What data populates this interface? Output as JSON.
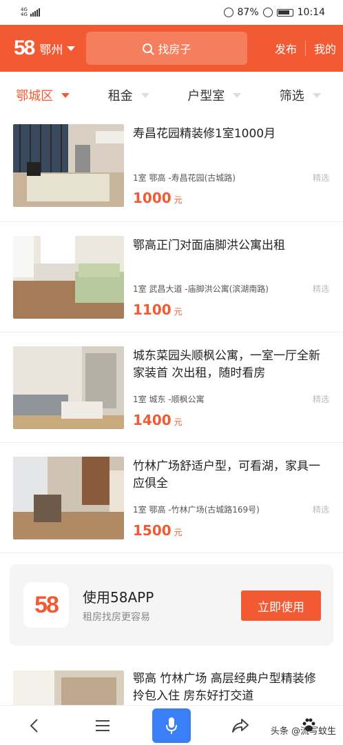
{
  "status_bar": {
    "network": "4G",
    "network_sub": "4G",
    "battery": "87%",
    "time": "10:14"
  },
  "header": {
    "logo": "58",
    "city": "鄂州",
    "search_placeholder": "找房子",
    "publish": "发布",
    "mine": "我的"
  },
  "filters": [
    {
      "label": "鄂城区",
      "active": true
    },
    {
      "label": "租金",
      "active": false
    },
    {
      "label": "户型室",
      "active": false
    },
    {
      "label": "筛选",
      "active": false
    }
  ],
  "listings": [
    {
      "title": "寿昌花园精装修1室1000月",
      "meta": "1室 鄂高 -寿昌花园(古城路)",
      "tag": "精选",
      "price": "1000",
      "unit": "元"
    },
    {
      "title": "鄂高正门对面庙脚洪公寓出租",
      "meta": "1室 武昌大道 -庙脚洪公寓(滨湖南路)",
      "tag": "精选",
      "price": "1100",
      "unit": "元"
    },
    {
      "title": "城东菜园头顺枫公寓，一室一厅全新家装首 次出租，随时看房",
      "meta": "1室 城东 -顺枫公寓",
      "tag": "精选",
      "price": "1400",
      "unit": "元"
    },
    {
      "title": "竹林广场舒适户型，可看湖，家具一应俱全",
      "meta": "1室 鄂高 -竹林广场(古城路169号)",
      "tag": "精选",
      "price": "1500",
      "unit": "元"
    }
  ],
  "promo": {
    "logo": "58",
    "title": "使用58APP",
    "subtitle": "租房找房更容易",
    "button": "立即使用"
  },
  "partial_listing": {
    "title": "鄂高 竹林广场 高层经典户型精装修 拎包入住 房东好打交道"
  },
  "watermark": "头条 @流写蚊生",
  "colors": {
    "accent": "#f25a33",
    "mic": "#3b7ff6"
  },
  "icons": {
    "back": "back-icon",
    "menu": "menu-icon",
    "mic": "mic-icon",
    "share": "share-icon",
    "paw": "paw-icon"
  }
}
